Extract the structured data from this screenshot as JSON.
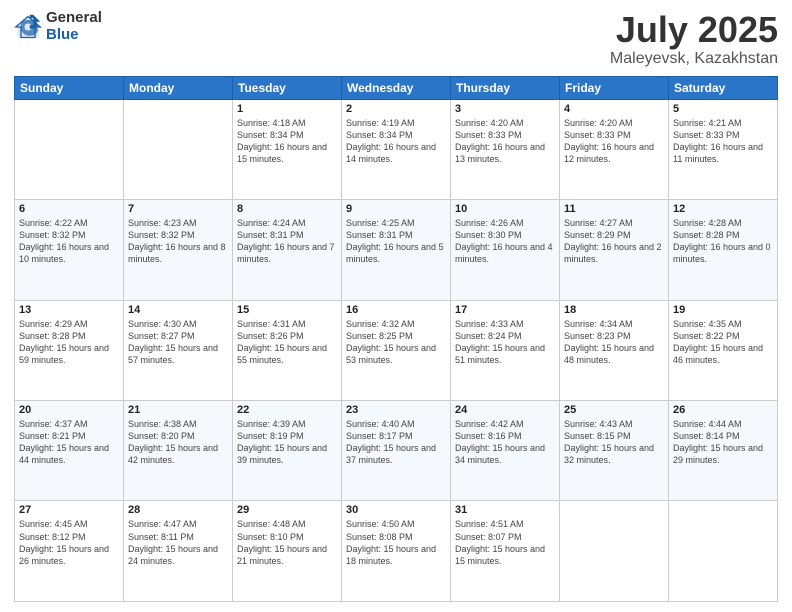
{
  "logo": {
    "general": "General",
    "blue": "Blue"
  },
  "title": {
    "month": "July 2025",
    "location": "Maleyevsk, Kazakhstan"
  },
  "weekdays": [
    "Sunday",
    "Monday",
    "Tuesday",
    "Wednesday",
    "Thursday",
    "Friday",
    "Saturday"
  ],
  "weeks": [
    [
      {
        "day": "",
        "sunrise": "",
        "sunset": "",
        "daylight": ""
      },
      {
        "day": "",
        "sunrise": "",
        "sunset": "",
        "daylight": ""
      },
      {
        "day": "1",
        "sunrise": "Sunrise: 4:18 AM",
        "sunset": "Sunset: 8:34 PM",
        "daylight": "Daylight: 16 hours and 15 minutes."
      },
      {
        "day": "2",
        "sunrise": "Sunrise: 4:19 AM",
        "sunset": "Sunset: 8:34 PM",
        "daylight": "Daylight: 16 hours and 14 minutes."
      },
      {
        "day": "3",
        "sunrise": "Sunrise: 4:20 AM",
        "sunset": "Sunset: 8:33 PM",
        "daylight": "Daylight: 16 hours and 13 minutes."
      },
      {
        "day": "4",
        "sunrise": "Sunrise: 4:20 AM",
        "sunset": "Sunset: 8:33 PM",
        "daylight": "Daylight: 16 hours and 12 minutes."
      },
      {
        "day": "5",
        "sunrise": "Sunrise: 4:21 AM",
        "sunset": "Sunset: 8:33 PM",
        "daylight": "Daylight: 16 hours and 11 minutes."
      }
    ],
    [
      {
        "day": "6",
        "sunrise": "Sunrise: 4:22 AM",
        "sunset": "Sunset: 8:32 PM",
        "daylight": "Daylight: 16 hours and 10 minutes."
      },
      {
        "day": "7",
        "sunrise": "Sunrise: 4:23 AM",
        "sunset": "Sunset: 8:32 PM",
        "daylight": "Daylight: 16 hours and 8 minutes."
      },
      {
        "day": "8",
        "sunrise": "Sunrise: 4:24 AM",
        "sunset": "Sunset: 8:31 PM",
        "daylight": "Daylight: 16 hours and 7 minutes."
      },
      {
        "day": "9",
        "sunrise": "Sunrise: 4:25 AM",
        "sunset": "Sunset: 8:31 PM",
        "daylight": "Daylight: 16 hours and 5 minutes."
      },
      {
        "day": "10",
        "sunrise": "Sunrise: 4:26 AM",
        "sunset": "Sunset: 8:30 PM",
        "daylight": "Daylight: 16 hours and 4 minutes."
      },
      {
        "day": "11",
        "sunrise": "Sunrise: 4:27 AM",
        "sunset": "Sunset: 8:29 PM",
        "daylight": "Daylight: 16 hours and 2 minutes."
      },
      {
        "day": "12",
        "sunrise": "Sunrise: 4:28 AM",
        "sunset": "Sunset: 8:28 PM",
        "daylight": "Daylight: 16 hours and 0 minutes."
      }
    ],
    [
      {
        "day": "13",
        "sunrise": "Sunrise: 4:29 AM",
        "sunset": "Sunset: 8:28 PM",
        "daylight": "Daylight: 15 hours and 59 minutes."
      },
      {
        "day": "14",
        "sunrise": "Sunrise: 4:30 AM",
        "sunset": "Sunset: 8:27 PM",
        "daylight": "Daylight: 15 hours and 57 minutes."
      },
      {
        "day": "15",
        "sunrise": "Sunrise: 4:31 AM",
        "sunset": "Sunset: 8:26 PM",
        "daylight": "Daylight: 15 hours and 55 minutes."
      },
      {
        "day": "16",
        "sunrise": "Sunrise: 4:32 AM",
        "sunset": "Sunset: 8:25 PM",
        "daylight": "Daylight: 15 hours and 53 minutes."
      },
      {
        "day": "17",
        "sunrise": "Sunrise: 4:33 AM",
        "sunset": "Sunset: 8:24 PM",
        "daylight": "Daylight: 15 hours and 51 minutes."
      },
      {
        "day": "18",
        "sunrise": "Sunrise: 4:34 AM",
        "sunset": "Sunset: 8:23 PM",
        "daylight": "Daylight: 15 hours and 48 minutes."
      },
      {
        "day": "19",
        "sunrise": "Sunrise: 4:35 AM",
        "sunset": "Sunset: 8:22 PM",
        "daylight": "Daylight: 15 hours and 46 minutes."
      }
    ],
    [
      {
        "day": "20",
        "sunrise": "Sunrise: 4:37 AM",
        "sunset": "Sunset: 8:21 PM",
        "daylight": "Daylight: 15 hours and 44 minutes."
      },
      {
        "day": "21",
        "sunrise": "Sunrise: 4:38 AM",
        "sunset": "Sunset: 8:20 PM",
        "daylight": "Daylight: 15 hours and 42 minutes."
      },
      {
        "day": "22",
        "sunrise": "Sunrise: 4:39 AM",
        "sunset": "Sunset: 8:19 PM",
        "daylight": "Daylight: 15 hours and 39 minutes."
      },
      {
        "day": "23",
        "sunrise": "Sunrise: 4:40 AM",
        "sunset": "Sunset: 8:17 PM",
        "daylight": "Daylight: 15 hours and 37 minutes."
      },
      {
        "day": "24",
        "sunrise": "Sunrise: 4:42 AM",
        "sunset": "Sunset: 8:16 PM",
        "daylight": "Daylight: 15 hours and 34 minutes."
      },
      {
        "day": "25",
        "sunrise": "Sunrise: 4:43 AM",
        "sunset": "Sunset: 8:15 PM",
        "daylight": "Daylight: 15 hours and 32 minutes."
      },
      {
        "day": "26",
        "sunrise": "Sunrise: 4:44 AM",
        "sunset": "Sunset: 8:14 PM",
        "daylight": "Daylight: 15 hours and 29 minutes."
      }
    ],
    [
      {
        "day": "27",
        "sunrise": "Sunrise: 4:45 AM",
        "sunset": "Sunset: 8:12 PM",
        "daylight": "Daylight: 15 hours and 26 minutes."
      },
      {
        "day": "28",
        "sunrise": "Sunrise: 4:47 AM",
        "sunset": "Sunset: 8:11 PM",
        "daylight": "Daylight: 15 hours and 24 minutes."
      },
      {
        "day": "29",
        "sunrise": "Sunrise: 4:48 AM",
        "sunset": "Sunset: 8:10 PM",
        "daylight": "Daylight: 15 hours and 21 minutes."
      },
      {
        "day": "30",
        "sunrise": "Sunrise: 4:50 AM",
        "sunset": "Sunset: 8:08 PM",
        "daylight": "Daylight: 15 hours and 18 minutes."
      },
      {
        "day": "31",
        "sunrise": "Sunrise: 4:51 AM",
        "sunset": "Sunset: 8:07 PM",
        "daylight": "Daylight: 15 hours and 15 minutes."
      },
      {
        "day": "",
        "sunrise": "",
        "sunset": "",
        "daylight": ""
      },
      {
        "day": "",
        "sunrise": "",
        "sunset": "",
        "daylight": ""
      }
    ]
  ]
}
